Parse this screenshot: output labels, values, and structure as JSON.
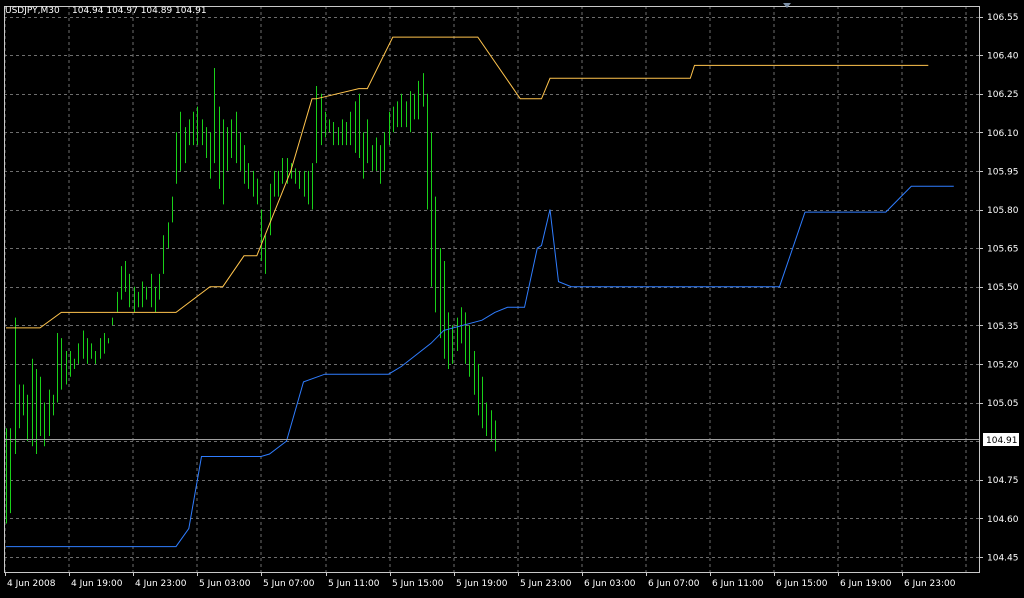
{
  "header": {
    "symbol": "USDJPY,M30",
    "quote": "104.94 104.97 104.89 104.91"
  },
  "price_tag": "104.91",
  "colors": {
    "background": "#000000",
    "grid": "#6e6e6e",
    "candles": "#19d119",
    "upper_band": "#ffc44d",
    "lower_band": "#2f7dff",
    "text": "#ffffff",
    "current_line": "#a0a0a0"
  },
  "chart_data": {
    "type": "bar",
    "title": "USDJPY,M30",
    "subtitle": "104.94 104.97 104.89 104.91",
    "xlabel": "",
    "ylabel": "",
    "ylim": [
      104.4,
      106.58
    ],
    "grid": true,
    "y_ticks": [
      "106.55",
      "106.40",
      "106.25",
      "106.10",
      "105.95",
      "105.80",
      "105.65",
      "105.50",
      "105.35",
      "105.20",
      "105.05",
      "104.90",
      "104.75",
      "104.60",
      "104.45"
    ],
    "x_ticks": [
      "4 Jun 2008",
      "4 Jun 19:00",
      "4 Jun 23:00",
      "5 Jun 03:00",
      "5 Jun 07:00",
      "5 Jun 11:00",
      "5 Jun 15:00",
      "5 Jun 19:00",
      "5 Jun 23:00",
      "6 Jun 03:00",
      "6 Jun 07:00",
      "6 Jun 11:00",
      "6 Jun 15:00",
      "6 Jun 19:00",
      "6 Jun 23:00"
    ],
    "current_price": 104.91,
    "bars": {
      "high": [
        104.95,
        104.95,
        105.38,
        105.12,
        105.12,
        105.08,
        105.22,
        105.18,
        105.15,
        105.05,
        105.1,
        105.08,
        105.32,
        105.3,
        105.25,
        105.25,
        105.22,
        105.28,
        105.33,
        105.3,
        105.28,
        105.25,
        105.3,
        105.32,
        105.3,
        105.38,
        105.48,
        105.58,
        105.6,
        105.55,
        105.5,
        105.48,
        105.52,
        105.5,
        105.55,
        105.5,
        105.55,
        105.7,
        105.75,
        105.85,
        106.1,
        106.18,
        106.12,
        106.15,
        106.18,
        106.2,
        106.15,
        106.12,
        106.1,
        106.35,
        106.2,
        106.15,
        106.12,
        106.15,
        106.18,
        106.1,
        106.05,
        105.98,
        105.95,
        105.92,
        105.8,
        105.7,
        105.9,
        105.95,
        105.95,
        106.0,
        106.0,
        105.98,
        105.96,
        105.95,
        105.95,
        105.95,
        105.98,
        106.28,
        106.25,
        106.18,
        106.15,
        106.14,
        106.12,
        106.15,
        106.14,
        106.18,
        106.22,
        106.25,
        106.1,
        106.15,
        106.05,
        106.08,
        106.05,
        106.1,
        106.18,
        106.2,
        106.22,
        106.25,
        106.22,
        106.26,
        106.25,
        106.3,
        106.33,
        106.25,
        106.1,
        105.85,
        105.65,
        105.6,
        105.4,
        105.35,
        105.38,
        105.42,
        105.4,
        105.35,
        105.25,
        105.2,
        105.15,
        105.05,
        105.02,
        104.98
      ],
      "low": [
        104.58,
        104.62,
        104.85,
        104.95,
        105.0,
        104.9,
        104.88,
        104.85,
        104.92,
        104.88,
        104.92,
        105.0,
        105.05,
        105.1,
        105.12,
        105.15,
        105.18,
        105.2,
        105.22,
        105.2,
        105.22,
        105.2,
        105.22,
        105.24,
        105.28,
        105.35,
        105.4,
        105.45,
        105.48,
        105.42,
        105.4,
        105.42,
        105.42,
        105.45,
        105.42,
        105.4,
        105.45,
        105.55,
        105.65,
        105.75,
        105.9,
        105.95,
        105.98,
        106.05,
        106.05,
        106.05,
        106.05,
        106.0,
        105.92,
        105.98,
        105.88,
        105.82,
        105.95,
        106.0,
        105.98,
        105.95,
        105.9,
        105.88,
        105.85,
        105.82,
        105.6,
        105.55,
        105.7,
        105.85,
        105.85,
        105.9,
        105.9,
        105.92,
        105.9,
        105.88,
        105.85,
        105.82,
        105.8,
        105.98,
        106.05,
        106.08,
        106.1,
        106.05,
        106.05,
        106.05,
        106.05,
        106.05,
        106.02,
        106.0,
        105.92,
        105.98,
        105.95,
        105.95,
        105.9,
        105.95,
        106.05,
        106.1,
        106.12,
        106.12,
        106.12,
        106.1,
        106.15,
        106.15,
        106.2,
        105.8,
        105.5,
        105.4,
        105.3,
        105.22,
        105.18,
        105.2,
        105.25,
        105.28,
        105.2,
        105.15,
        105.08,
        105.0,
        104.95,
        104.92,
        104.9,
        104.86
      ]
    },
    "series": [
      {
        "name": "",
        "x": [
          0,
          8,
          13,
          40,
          48,
          51,
          56,
          59,
          67,
          72,
          73,
          83,
          85,
          91,
          95,
          111,
          121,
          126,
          128,
          152,
          161,
          162,
          188,
          193,
          203,
          204,
          215,
          216,
          217
        ],
        "y": [
          105.34,
          105.34,
          105.4,
          105.4,
          105.5,
          105.5,
          105.62,
          105.62,
          105.95,
          106.23,
          106.23,
          106.27,
          106.27,
          106.47,
          106.47,
          106.47,
          106.23,
          106.23,
          106.31,
          106.31,
          106.31,
          106.36,
          106.36,
          106.36,
          106.36,
          106.36,
          106.36,
          106.36,
          106.36
        ]
      },
      {
        "name": "",
        "x": [
          0,
          40,
          43,
          46,
          60,
          62,
          66,
          70,
          75,
          90,
          93,
          100,
          103,
          112,
          115,
          118,
          122,
          125,
          126,
          128,
          130,
          133,
          139,
          140,
          150,
          155,
          160,
          169,
          175,
          182,
          188,
          196,
          207,
          213,
          215,
          223
        ],
        "y": [
          104.49,
          104.49,
          104.56,
          104.84,
          104.84,
          104.85,
          104.9,
          105.13,
          105.16,
          105.16,
          105.19,
          105.28,
          105.33,
          105.37,
          105.4,
          105.42,
          105.42,
          105.65,
          105.66,
          105.8,
          105.52,
          105.5,
          105.5,
          105.5,
          105.5,
          105.5,
          105.5,
          105.5,
          105.5,
          105.5,
          105.79,
          105.79,
          105.79,
          105.89,
          105.89,
          105.89
        ]
      }
    ]
  }
}
